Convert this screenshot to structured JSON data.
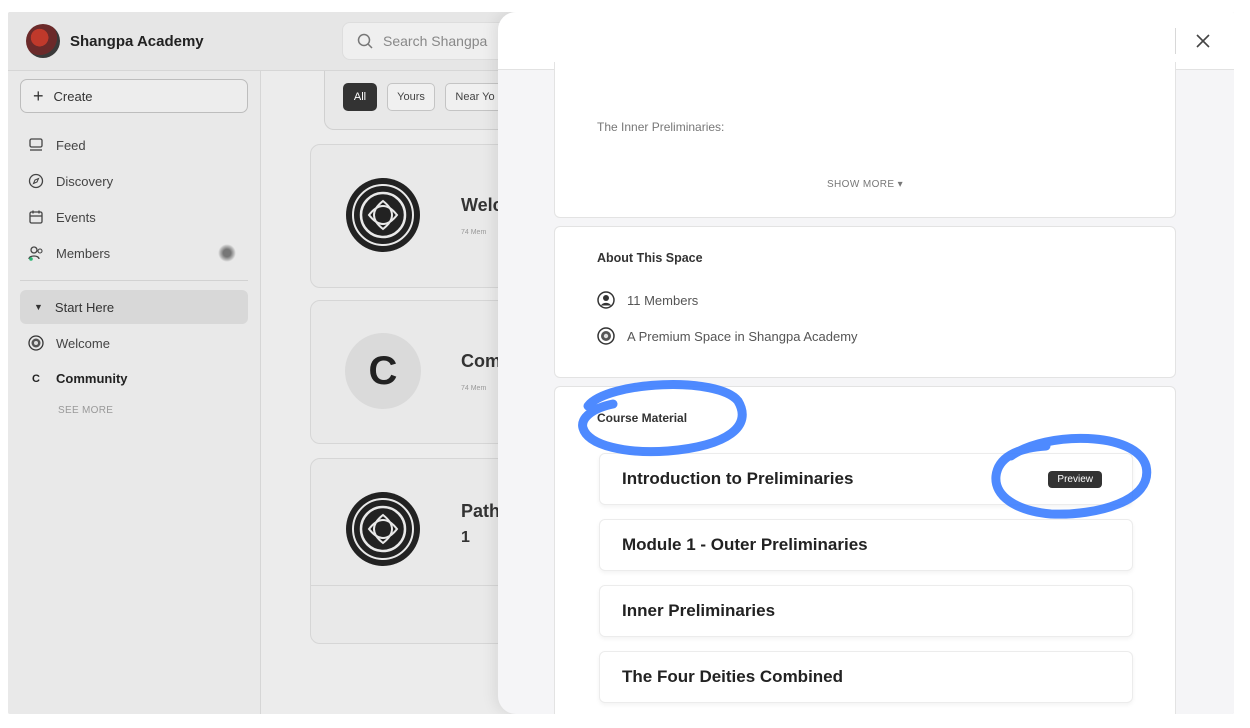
{
  "brand": {
    "name": "Shangpa Academy"
  },
  "search": {
    "placeholder": "Search Shangpa"
  },
  "sidebar": {
    "create_label": "Create",
    "nav": [
      {
        "label": "Feed",
        "icon": "feed-icon"
      },
      {
        "label": "Discovery",
        "icon": "compass-icon"
      },
      {
        "label": "Events",
        "icon": "calendar-icon"
      },
      {
        "label": "Members",
        "icon": "members-icon"
      }
    ],
    "section_label": "Start Here",
    "spaces": [
      {
        "label": "Welcome",
        "icon": "emblem-icon"
      },
      {
        "label": "Community",
        "icon": "letter-c-icon",
        "initial": "C"
      }
    ],
    "see_more": "SEE MORE"
  },
  "filters": [
    "All",
    "Yours",
    "Near Yo"
  ],
  "cards": [
    {
      "title": "Welc",
      "sub": "74 Mem"
    },
    {
      "title": "Com",
      "sub": "74 Mem",
      "initial": "C"
    },
    {
      "title_line1": "Path",
      "title_line2": "1"
    }
  ],
  "modal": {
    "description_heading": "The Inner Preliminaries:",
    "show_more": "SHOW MORE ▾",
    "about": {
      "title": "About This Space",
      "members": "11 Members",
      "premium": "A Premium Space in Shangpa Academy"
    },
    "course": {
      "title": "Course Material",
      "modules": [
        {
          "label": "Introduction to Preliminaries",
          "badge": "Preview"
        },
        {
          "label": "Module 1 - Outer Preliminaries"
        },
        {
          "label": "Inner Preliminaries"
        },
        {
          "label": "The Four Deities Combined"
        }
      ]
    }
  },
  "colors": {
    "annotation": "#3b7dff",
    "badge": "#333333"
  }
}
